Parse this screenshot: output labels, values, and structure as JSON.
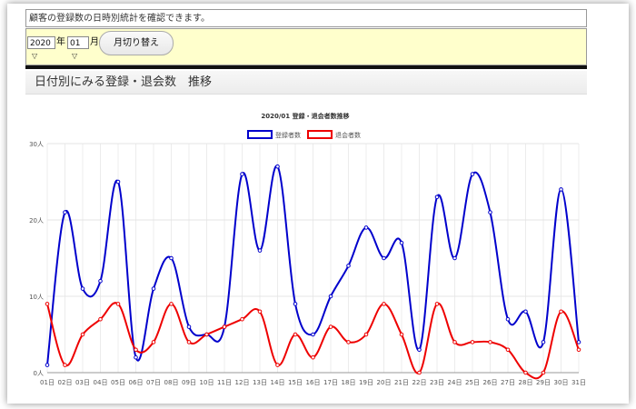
{
  "description": "顧客の登録数の日時別統計を確認できます。",
  "controls": {
    "year_value": "2020",
    "year_unit": "年",
    "month_value": "01",
    "month_unit": "月",
    "switch_label": "月切り替え"
  },
  "section_title": "日付別にみる登録・退会数　推移",
  "chart_data": {
    "type": "line",
    "title": "2020/01 登録・退会者数推移",
    "categories": [
      "01日",
      "02日",
      "03日",
      "04日",
      "05日",
      "06日",
      "07日",
      "08日",
      "09日",
      "10日",
      "11日",
      "12日",
      "13日",
      "14日",
      "15日",
      "16日",
      "17日",
      "18日",
      "19日",
      "20日",
      "21日",
      "22日",
      "23日",
      "24日",
      "25日",
      "26日",
      "27日",
      "28日",
      "29日",
      "30日",
      "31日"
    ],
    "y_ticks": [
      "0人",
      "10人",
      "20人",
      "30人"
    ],
    "ylim": [
      0,
      30
    ],
    "grid": true,
    "legend_position": "top-center",
    "series": [
      {
        "name": "登録者数",
        "color": "#0000cc",
        "values": [
          1,
          21,
          11,
          12,
          25,
          2,
          11,
          15,
          6,
          5,
          6,
          26,
          16,
          27,
          9,
          5,
          10,
          14,
          19,
          15,
          17,
          3,
          23,
          15,
          26,
          21,
          7,
          8,
          4,
          24,
          4
        ]
      },
      {
        "name": "退会者数",
        "color": "#ee0000",
        "values": [
          9,
          1,
          5,
          7,
          9,
          3,
          4,
          9,
          4,
          5,
          6,
          7,
          8,
          1,
          5,
          2,
          6,
          4,
          5,
          9,
          5,
          0,
          9,
          4,
          4,
          4,
          3,
          0,
          0,
          8,
          3
        ]
      }
    ]
  }
}
